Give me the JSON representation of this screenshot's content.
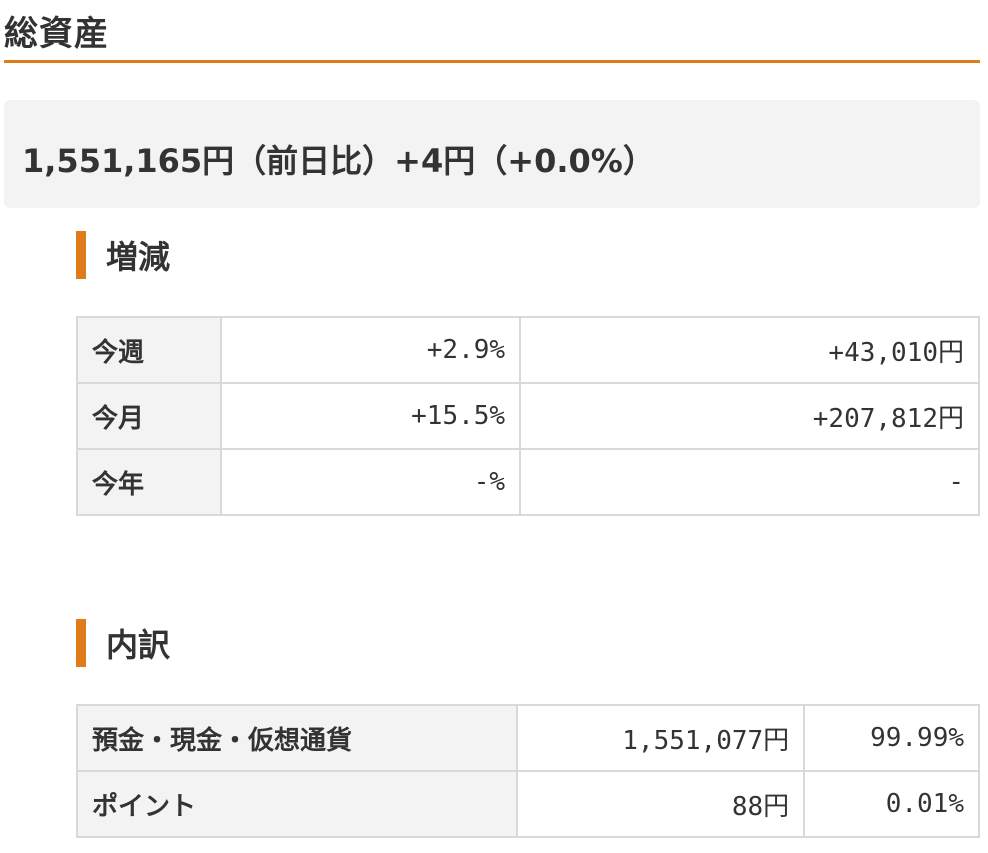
{
  "page": {
    "title": "総資産"
  },
  "summary": {
    "text": "1,551,165円（前日比）+4円（+0.0%）"
  },
  "change": {
    "heading": "増減",
    "rows": [
      {
        "label": "今週",
        "percent": "+2.9%",
        "amount": "+43,010円"
      },
      {
        "label": "今月",
        "percent": "+15.5%",
        "amount": "+207,812円"
      },
      {
        "label": "今年",
        "percent": "-%",
        "amount": "-"
      }
    ]
  },
  "breakdown": {
    "heading": "内訳",
    "rows": [
      {
        "label": "預金・現金・仮想通貨",
        "amount": "1,551,077円",
        "share": "99.99%"
      },
      {
        "label": "ポイント",
        "amount": "88円",
        "share": "0.01%"
      }
    ]
  },
  "colors": {
    "accent": "#e07b1a",
    "label_background": "#f3f3f3",
    "border": "#d9d9d9",
    "text": "#333333"
  }
}
